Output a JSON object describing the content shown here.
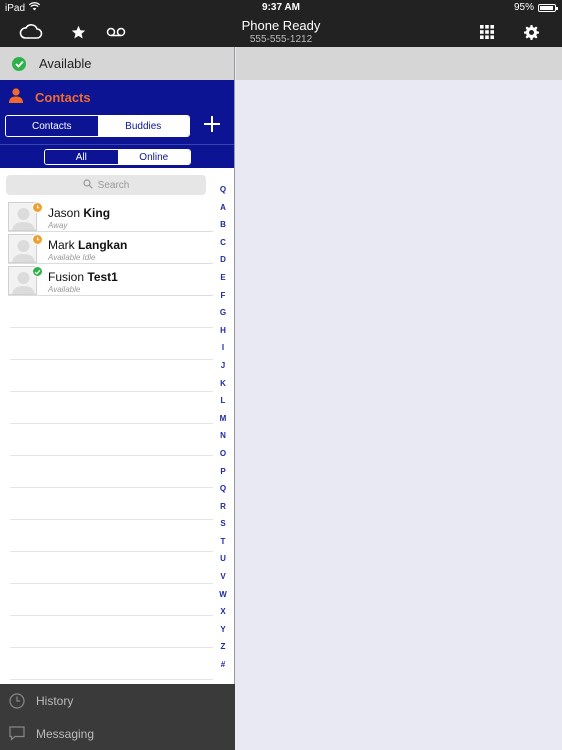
{
  "status_bar": {
    "device": "iPad",
    "time": "9:37 AM",
    "battery_text": "95%",
    "battery_level": 0.95
  },
  "toolbar": {
    "title": "Phone Ready",
    "subtitle": "555-555-1212",
    "icons_left": [
      "cloud-icon",
      "star-icon",
      "voicemail-icon"
    ],
    "icons_right": [
      "keypad-icon",
      "gear-icon"
    ]
  },
  "presence": {
    "label": "Available",
    "color": "#2db24a"
  },
  "contacts": {
    "title": "Contacts",
    "title_color": "#f16a2c",
    "header_color": "#0c1494",
    "tabs": [
      {
        "label": "Contacts",
        "selected": true
      },
      {
        "label": "Buddies",
        "selected": false
      }
    ],
    "filters": [
      {
        "label": "All",
        "selected": true
      },
      {
        "label": "Online",
        "selected": false
      }
    ],
    "search_placeholder": "Search",
    "items": [
      {
        "first": "Jason",
        "last": "King",
        "status": "Away",
        "badge": "away",
        "badge_color": "#f0a030"
      },
      {
        "first": "Mark",
        "last": "Langkan",
        "status": "Available Idle",
        "badge": "idle",
        "badge_color": "#f0a030"
      },
      {
        "first": "Fusion",
        "last": "Test1",
        "status": "Available",
        "badge": "available",
        "badge_color": "#2db24a"
      }
    ],
    "index_letters": [
      "Q",
      "A",
      "B",
      "C",
      "D",
      "E",
      "F",
      "G",
      "H",
      "I",
      "J",
      "K",
      "L",
      "M",
      "N",
      "O",
      "P",
      "Q",
      "R",
      "S",
      "T",
      "U",
      "V",
      "W",
      "X",
      "Y",
      "Z",
      "#"
    ]
  },
  "bottom_nav": [
    {
      "label": "History",
      "icon": "clock-icon"
    },
    {
      "label": "Messaging",
      "icon": "chat-bubble-icon"
    }
  ]
}
